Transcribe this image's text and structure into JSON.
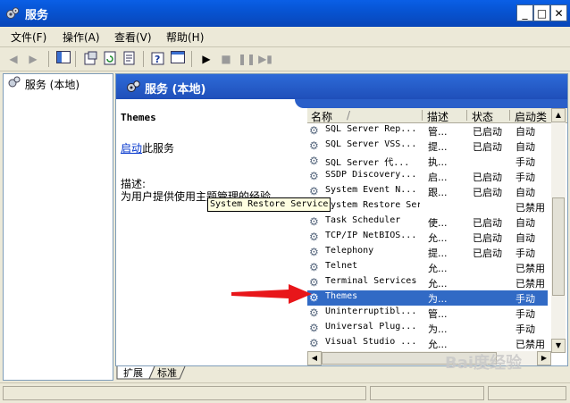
{
  "window": {
    "title": "服务"
  },
  "window_controls": {
    "minimize": "_",
    "maximize": "□",
    "close": "✕"
  },
  "menu": [
    {
      "label": "文件(F)"
    },
    {
      "label": "操作(A)"
    },
    {
      "label": "查看(V)"
    },
    {
      "label": "帮助(H)"
    }
  ],
  "tree": {
    "root": "服务 (本地)"
  },
  "right": {
    "header": "服务 (本地)",
    "service_title": "Themes",
    "start_link": "启动",
    "start_suffix": "此服务",
    "desc_label": "描述:",
    "description": "为用户提供使用主题管理的经验。"
  },
  "columns": {
    "name": "名称",
    "sort_indicator": "/",
    "desc": "描述",
    "status": "状态",
    "startup": "启动类"
  },
  "rows": [
    {
      "name": "SQL Server Rep...",
      "desc": "管...",
      "status": "已启动",
      "startup": "自动"
    },
    {
      "name": "SQL Server VSS...",
      "desc": "提...",
      "status": "已启动",
      "startup": "自动"
    },
    {
      "name": "SQL Server 代...",
      "desc": "执...",
      "status": "",
      "startup": "手动"
    },
    {
      "name": "SSDP Discovery...",
      "desc": "启...",
      "status": "已启动",
      "startup": "手动"
    },
    {
      "name": "System Event N...",
      "desc": "跟...",
      "status": "已启动",
      "startup": "自动"
    },
    {
      "name": "System Restore Service",
      "desc": "",
      "status": "",
      "startup": "已禁用"
    },
    {
      "name": "Task Scheduler",
      "desc": "使...",
      "status": "已启动",
      "startup": "自动"
    },
    {
      "name": "TCP/IP NetBIOS...",
      "desc": "允...",
      "status": "已启动",
      "startup": "自动"
    },
    {
      "name": "Telephony",
      "desc": "提...",
      "status": "已启动",
      "startup": "手动"
    },
    {
      "name": "Telnet",
      "desc": "允...",
      "status": "",
      "startup": "已禁用"
    },
    {
      "name": "Terminal Services",
      "desc": "允...",
      "status": "",
      "startup": "已禁用"
    },
    {
      "name": "Themes",
      "desc": "为...",
      "status": "",
      "startup": "手动",
      "selected": true
    },
    {
      "name": "Uninterruptibl...",
      "desc": "管...",
      "status": "",
      "startup": "手动"
    },
    {
      "name": "Universal Plug...",
      "desc": "为...",
      "status": "",
      "startup": "手动"
    },
    {
      "name": "Visual Studio ...",
      "desc": "允...",
      "status": "",
      "startup": "已禁用"
    }
  ],
  "tooltip": "System Restore Service",
  "tabs": [
    {
      "label": "扩展"
    },
    {
      "label": "标准"
    }
  ],
  "watermark": "Bai度经验",
  "colors": {
    "selection": "#316ac5",
    "titlebar": "#0754d3",
    "arrow": "#e8161a"
  }
}
